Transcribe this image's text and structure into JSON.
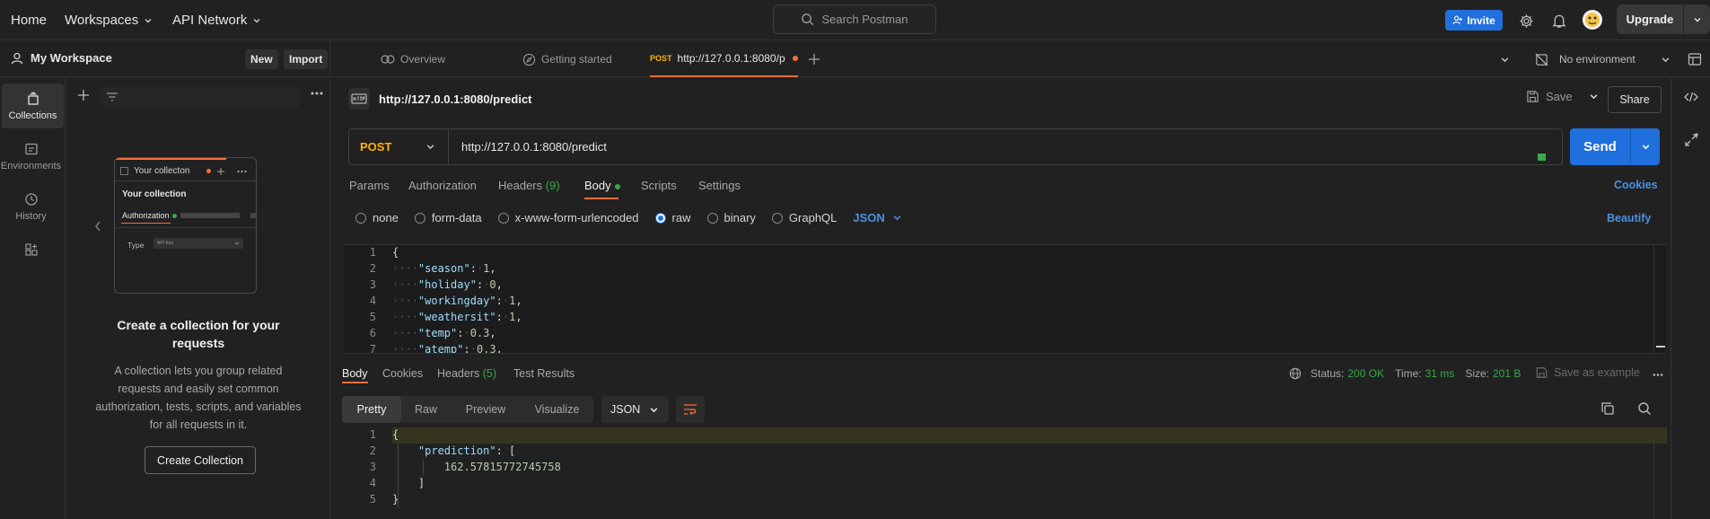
{
  "topbar": {
    "home": "Home",
    "workspaces": "Workspaces",
    "api_network": "API Network",
    "search_placeholder": "Search Postman",
    "invite": "Invite",
    "upgrade": "Upgrade"
  },
  "workspace": {
    "name": "My Workspace",
    "new_label": "New",
    "import_label": "Import"
  },
  "tabs": {
    "overview": "Overview",
    "getting_started": "Getting started",
    "active_method": "POST",
    "active_url": "http://127.0.0.1:8080/p",
    "environment": "No environment"
  },
  "rail": {
    "collections": "Collections",
    "environments": "Environments",
    "history": "History"
  },
  "side": {
    "illustration": {
      "collection_tab": "Your collecton",
      "collection_title": "Your collection",
      "auth_tab": "Authorization",
      "type_label": "Type",
      "type_value": "API Key"
    },
    "heading": "Create a collection for your requests",
    "description": "A collection lets you group related requests and easily set common authorization, tests, scripts, and variables for all requests in it.",
    "create_button": "Create Collection"
  },
  "request": {
    "title": "http://127.0.0.1:8080/predict",
    "save": "Save",
    "share": "Share",
    "method": "POST",
    "url": "http://127.0.0.1:8080/predict",
    "send": "Send",
    "tabs": {
      "params": "Params",
      "authorization": "Authorization",
      "headers": "Headers",
      "headers_count": "(9)",
      "body": "Body",
      "scripts": "Scripts",
      "settings": "Settings"
    },
    "cookies": "Cookies",
    "beautify": "Beautify",
    "body_types": {
      "none": "none",
      "form_data": "form-data",
      "urlencoded": "x-www-form-urlencoded",
      "raw": "raw",
      "binary": "binary",
      "graphql": "GraphQL",
      "selected_format": "JSON"
    },
    "body_lines": [
      {
        "n": "1",
        "text": "{"
      },
      {
        "n": "2",
        "key": "\"season\"",
        "val": "1"
      },
      {
        "n": "3",
        "key": "\"holiday\"",
        "val": "0"
      },
      {
        "n": "4",
        "key": "\"workingday\"",
        "val": "1"
      },
      {
        "n": "5",
        "key": "\"weathersit\"",
        "val": "1"
      },
      {
        "n": "6",
        "key": "\"temp\"",
        "val": "0.3"
      },
      {
        "n": "7",
        "key": "\"atemp\"",
        "val": "0.3"
      }
    ]
  },
  "response": {
    "tabs": {
      "body": "Body",
      "cookies": "Cookies",
      "headers": "Headers",
      "headers_count": "(5)",
      "test_results": "Test Results"
    },
    "status_label": "Status:",
    "status_value": "200 OK",
    "time_label": "Time:",
    "time_value": "31 ms",
    "size_label": "Size:",
    "size_value": "201 B",
    "save_example": "Save as example",
    "formats": {
      "pretty": "Pretty",
      "raw": "Raw",
      "preview": "Preview",
      "visualize": "Visualize",
      "json": "JSON"
    },
    "body_lines": [
      {
        "n": "1",
        "text": "{"
      },
      {
        "n": "2",
        "key": "\"prediction\"",
        "text": ": ["
      },
      {
        "n": "3",
        "val": "162.57815772745758"
      },
      {
        "n": "4",
        "text": "]"
      },
      {
        "n": "5",
        "text": "}"
      }
    ]
  }
}
